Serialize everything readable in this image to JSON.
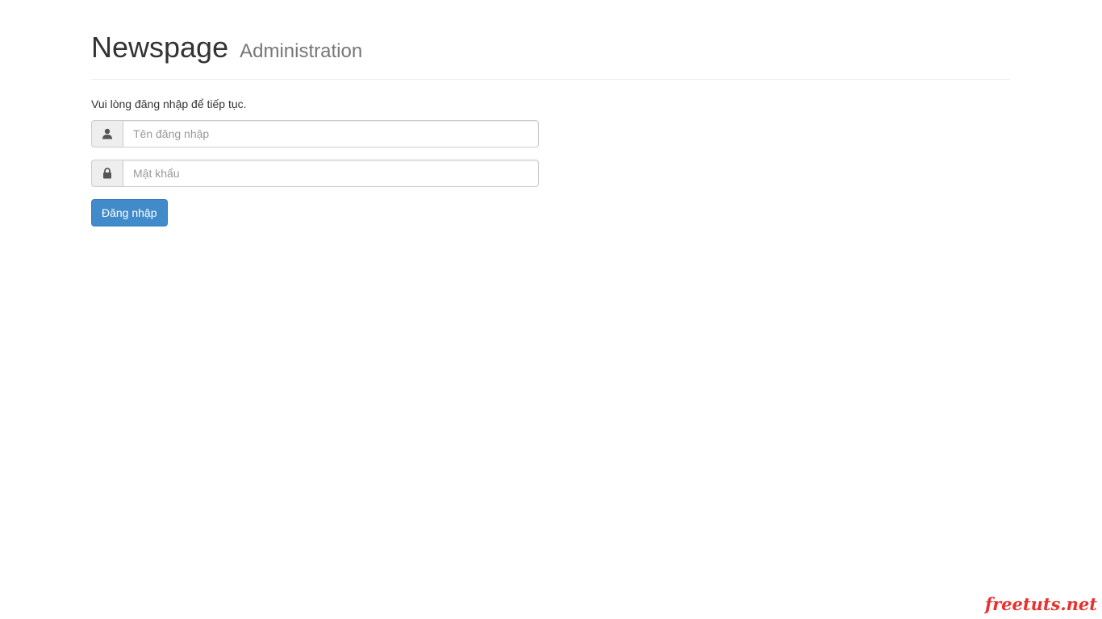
{
  "header": {
    "title": "Newspage",
    "subtitle": "Administration"
  },
  "form": {
    "instructions": "Vui lòng đăng nhập để tiếp tục.",
    "username": {
      "icon": "user-icon",
      "placeholder": "Tên đăng nhập",
      "value": ""
    },
    "password": {
      "icon": "lock-icon",
      "placeholder": "Mật khẩu",
      "value": ""
    },
    "submit_label": "Đăng nhập"
  },
  "watermark": "freetuts.net",
  "colors": {
    "primary": "#428bca",
    "watermark": "#e8312f"
  }
}
